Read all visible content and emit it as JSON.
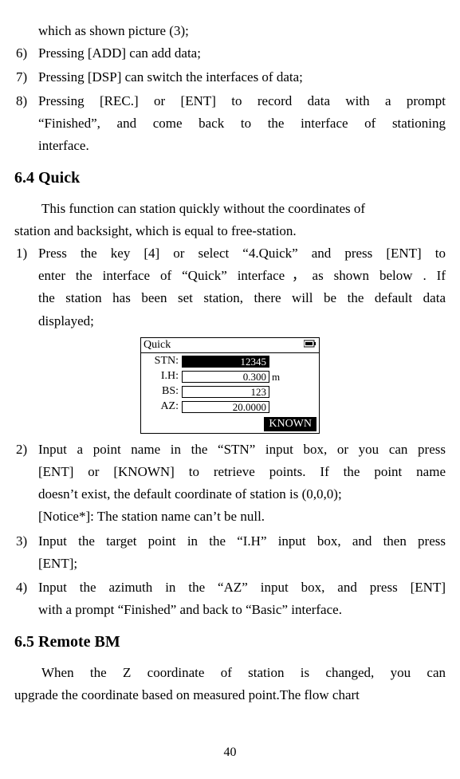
{
  "top_continued": "which as shown picture (3);",
  "list1": [
    {
      "n": "6)",
      "t": "Pressing [ADD] can add data;"
    },
    {
      "n": "7)",
      "t": "Pressing [DSP] can switch the interfaces of data;"
    }
  ],
  "item8": {
    "n": "8)",
    "line1": "Pressing [REC.] or [ENT] to record data with a prompt",
    "line2": "“Finished”, and come back to the interface of stationing",
    "line3": "interface."
  },
  "heading_quick": "6.4 Quick",
  "quick_intro_l1": "This function can station quickly without the coordinates of",
  "quick_intro_l2": "station and backsight, which is equal to free-station.",
  "quick_step1": {
    "n": "1)",
    "l1": "Press the key [4] or select “4.Quick” and press [ENT] to",
    "l2": "enter the interface of “Quick” interface，as shown below . If",
    "l3": "the station has been set station, there will be the default data",
    "l4": "displayed;"
  },
  "panel": {
    "title": "Quick",
    "stn_label": "STN:",
    "stn_value": "12345",
    "ih_label": "I.H:",
    "ih_value": "0.300",
    "ih_unit": "m",
    "bs_label": "BS:",
    "bs_value": "123",
    "az_label": "AZ:",
    "az_value": "20.0000",
    "known_btn": "KNOWN"
  },
  "quick_step2": {
    "n": "2)",
    "l1": "Input a point name in the “STN” input box, or you can press",
    "l2": "[ENT] or [KNOWN] to retrieve points. If the point name",
    "l3": "doesn’t exist, the default coordinate of station is (0,0,0);",
    "notice": "[Notice*]: The station name can’t be null."
  },
  "quick_step3": {
    "n": "3)",
    "l1": "Input the target point in the “I.H” input box, and then press",
    "l2": "[ENT];"
  },
  "quick_step4": {
    "n": "4)",
    "l1": "Input the azimuth in the “AZ” input box, and press [ENT]",
    "l2": "with a prompt “Finished” and back to “Basic” interface."
  },
  "heading_remote": "6.5 Remote BM",
  "remote_l1": "When the Z coordinate of station is changed, you can",
  "remote_l2": "upgrade the coordinate based on measured point.The flow chart",
  "page_number": "40"
}
